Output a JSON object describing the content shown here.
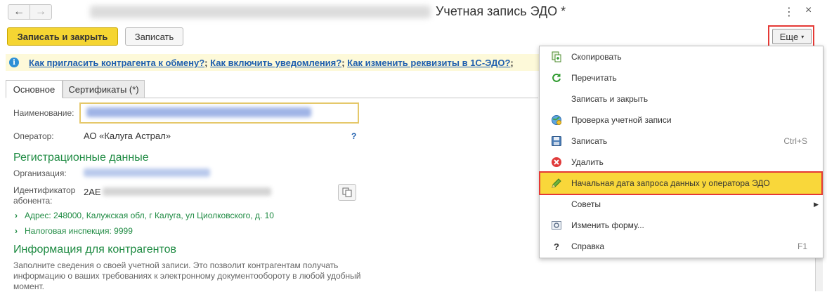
{
  "window": {
    "title": "Учетная запись ЭДО *",
    "back_icon": "←",
    "forward_icon": "→",
    "menu_icon": "⋮",
    "close_icon": "×"
  },
  "toolbar": {
    "save_close_label": "Записать и закрыть",
    "save_label": "Записать",
    "more_label": "Еще",
    "more_caret": "▾"
  },
  "info": {
    "icon": "i",
    "links": [
      "Как пригласить контрагента к обмену?",
      "Как включить уведомления?",
      "Как изменить реквизиты в 1С-ЭДО?"
    ],
    "separator": ";"
  },
  "tabs": [
    {
      "label": "Основное"
    },
    {
      "label": "Сертификаты (*)"
    }
  ],
  "form": {
    "name_label": "Наименование:",
    "operator_label": "Оператор:",
    "operator_value": "АО «Калуга Астрал»",
    "help_label": "?",
    "reg_section": "Регистрационные данные",
    "org_label": "Организация:",
    "subscriber_label_1": "Идентификатор",
    "subscriber_label_2": "абонента:",
    "subscriber_prefix": "2AE",
    "address_line": "Адрес: 248000, Калужская обл, г Калуга, ул Циолковского, д. 10",
    "tax_line": "Налоговая инспекция: 9999",
    "contractors_section": "Информация для контрагентов",
    "contractors_desc": "Заполните сведения о своей учетной записи. Это позволит контрагентам получать информацию о ваших требованиях к электронному документообороту в любой удобный момент."
  },
  "menu": [
    {
      "label": "Скопировать",
      "shortcut": "",
      "icon": "copy-icon"
    },
    {
      "label": "Перечитать",
      "shortcut": "",
      "icon": "refresh-icon"
    },
    {
      "label": "Записать и закрыть",
      "shortcut": "",
      "icon": ""
    },
    {
      "label": "Проверка учетной записи",
      "shortcut": "",
      "icon": "globe-check-icon"
    },
    {
      "label": "Записать",
      "shortcut": "Ctrl+S",
      "icon": "save-icon"
    },
    {
      "label": "Удалить",
      "shortcut": "",
      "icon": "delete-icon"
    },
    {
      "label": "Начальная дата запроса данных у оператора ЭДО",
      "shortcut": "",
      "icon": "pencil-icon"
    },
    {
      "label": "Советы",
      "shortcut": "",
      "icon": "",
      "submenu_arrow": "▶"
    },
    {
      "label": "Изменить форму...",
      "shortcut": "",
      "icon": "form-settings-icon"
    },
    {
      "label": "Справка",
      "shortcut": "F1",
      "icon": "help-icon"
    }
  ],
  "colors": {
    "primary_button": "#f5d532",
    "section_heading": "#1f8b43",
    "link": "#1f5fae",
    "highlight_border": "#e53935",
    "selected_menu": "#f9d73a"
  }
}
